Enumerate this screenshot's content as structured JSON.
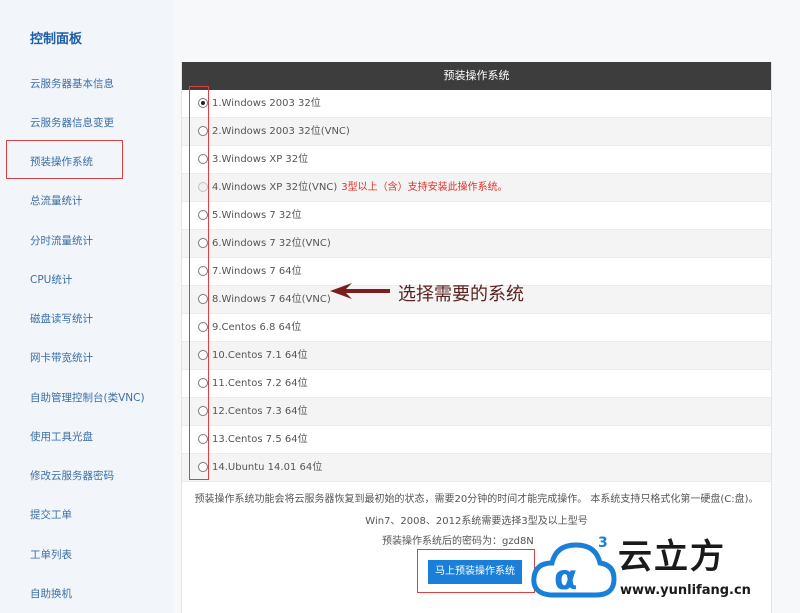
{
  "sidebar": {
    "title": "控制面板",
    "items": [
      {
        "label": "云服务器基本信息"
      },
      {
        "label": "云服务器信息变更"
      },
      {
        "label": "预装操作系统"
      },
      {
        "label": "总流量统计"
      },
      {
        "label": "分时流量统计"
      },
      {
        "label": "CPU统计"
      },
      {
        "label": "磁盘读写统计"
      },
      {
        "label": "网卡带宽统计"
      },
      {
        "label": "自助管理控制台(类VNC)"
      },
      {
        "label": "使用工具光盘"
      },
      {
        "label": "修改云服务器密码"
      },
      {
        "label": "提交工单"
      },
      {
        "label": "工单列表"
      },
      {
        "label": "自助换机"
      }
    ]
  },
  "panel": {
    "title": "预装操作系统",
    "options": [
      {
        "label": "1.Windows 2003 32位",
        "checked": true
      },
      {
        "label": "2.Windows 2003 32位(VNC)"
      },
      {
        "label": "3.Windows XP 32位"
      },
      {
        "label": "4.Windows XP 32位(VNC)",
        "note": "3型以上（含）支持安装此操作系统。",
        "disabled": true
      },
      {
        "label": "5.Windows 7 32位"
      },
      {
        "label": "6.Windows 7 32位(VNC)"
      },
      {
        "label": "7.Windows 7 64位"
      },
      {
        "label": "8.Windows 7 64位(VNC)"
      },
      {
        "label": "9.Centos 6.8 64位"
      },
      {
        "label": "10.Centos 7.1 64位"
      },
      {
        "label": "11.Centos 7.2 64位"
      },
      {
        "label": "12.Centos 7.3 64位"
      },
      {
        "label": "13.Centos 7.5 64位"
      },
      {
        "label": "14.Ubuntu 14.01 64位"
      }
    ],
    "info_line1": "预装操作系统功能会将云服务器恢复到最初始的状态，需要20分钟的时间才能完成操作。 本系统支持只格式化第一硬盘(C:盘)。",
    "info_line2": "Win7、2008、2012系统需要选择3型及以上型号",
    "info_line3": "预装操作系统后的密码为：gzd8N",
    "submit_label": "马上预装操作系统"
  },
  "annotation": {
    "callout_text": "选择需要的系统",
    "arrow_color": "#7a1e1e",
    "highlight_color": "#d9423f"
  },
  "watermark": {
    "logo_text": "云立方",
    "url": "www.yunlifang.cn",
    "superscript": "3"
  }
}
